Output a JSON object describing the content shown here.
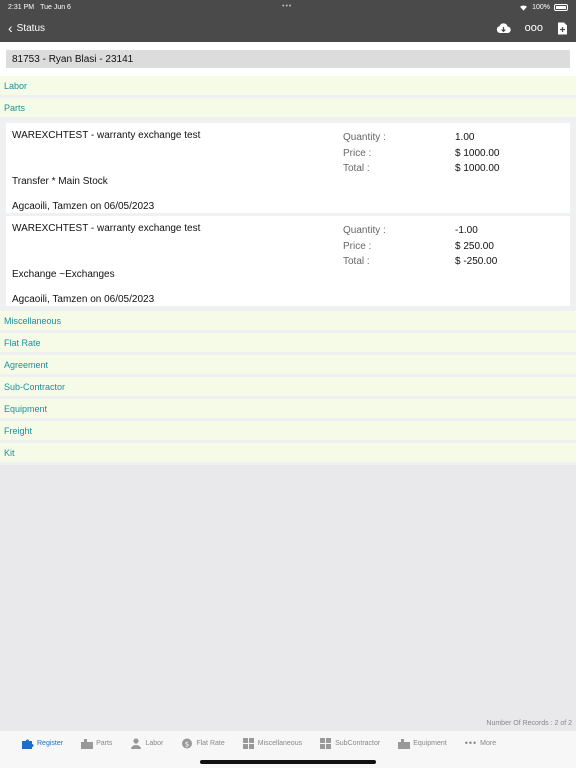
{
  "status_bar": {
    "time": "2:31 PM",
    "date": "Tue Jun 6",
    "battery": "100%"
  },
  "nav": {
    "back_label": "Status",
    "more_label": "ooo"
  },
  "header": {
    "title": "81753 - Ryan Blasi - 23141"
  },
  "sections": {
    "labor": "Labor",
    "parts": "Parts",
    "miscellaneous": "Miscellaneous",
    "flat_rate": "Flat Rate",
    "agreement": "Agreement",
    "sub_contractor": "Sub-Contractor",
    "equipment": "Equipment",
    "freight": "Freight",
    "kit": "Kit"
  },
  "field_labels": {
    "quantity": "Quantity :",
    "price": "Price :",
    "total": "Total :"
  },
  "parts": [
    {
      "description": "WAREXCHTEST - warranty exchange test",
      "quantity": "1.00",
      "price": "$ 1000.00",
      "total": "$ 1000.00",
      "location": "Transfer * Main Stock",
      "by": "Agcaoili, Tamzen on 06/05/2023"
    },
    {
      "description": "WAREXCHTEST - warranty exchange test",
      "quantity": "-1.00",
      "price": "$ 250.00",
      "total": "$ -250.00",
      "location": "Exchange ~Exchanges",
      "by": "Agcaoili, Tamzen on 06/05/2023"
    }
  ],
  "footer": {
    "records": "Number Of Records : 2 of 2"
  },
  "tabs": {
    "register": "Register",
    "parts": "Parts",
    "labor": "Labor",
    "flat_rate": "Flat Rate",
    "miscellaneous": "Miscellaneous",
    "subcontractor": "SubContractor",
    "equipment": "Equipment",
    "more": "More"
  },
  "colors": {
    "accent": "#1c8f9a",
    "tab_active": "#1c6fc4",
    "nav_bg": "#4a4a4a",
    "section_bg": "#f6fbe8"
  }
}
